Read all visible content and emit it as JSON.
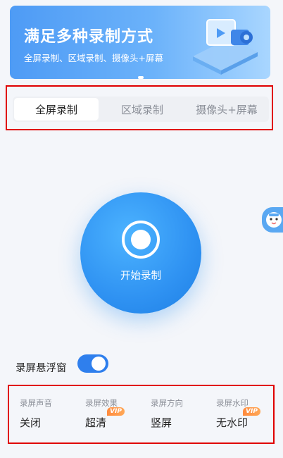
{
  "banner": {
    "title": "满足多种录制方式",
    "subtitle": "全屏录制、区域录制、摄像头+屏幕"
  },
  "tabs": [
    {
      "label": "全屏录制",
      "active": true
    },
    {
      "label": "区域录制",
      "active": false
    },
    {
      "label": "摄像头+屏幕",
      "active": false
    }
  ],
  "record": {
    "label": "开始录制"
  },
  "floating_window": {
    "label": "录屏悬浮窗",
    "enabled": true
  },
  "settings": [
    {
      "label": "录屏声音",
      "value": "关闭",
      "vip": ""
    },
    {
      "label": "录屏效果",
      "value": "超清",
      "vip": "VIP"
    },
    {
      "label": "录屏方向",
      "value": "竖屏",
      "vip": ""
    },
    {
      "label": "录屏水印",
      "value": "无水印",
      "vip": "VIP"
    }
  ],
  "colors": {
    "accent": "#2f92f2",
    "highlight_frame": "#e00000",
    "vip": "#ff8a3d"
  }
}
